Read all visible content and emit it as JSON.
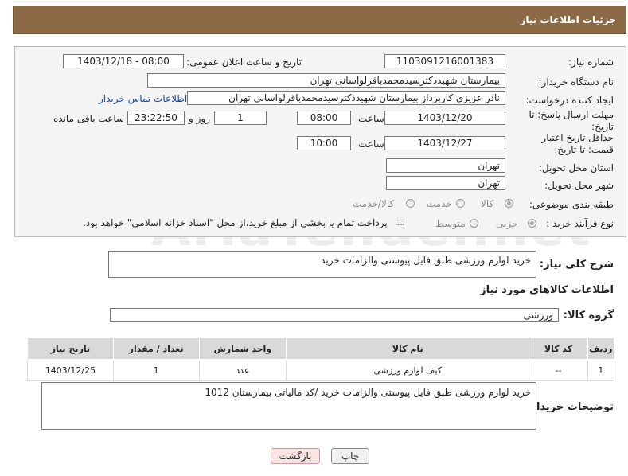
{
  "header": {
    "title": "جزئیات اطلاعات نیاز"
  },
  "form": {
    "need_number_label": "شماره نیاز:",
    "need_number": "1103091216001383",
    "announce_label": "تاریخ و ساعت اعلان عمومی:",
    "announce_value": "1403/12/18 - 08:00",
    "buyer_org_label": "نام دستگاه خریدار:",
    "buyer_org": "بیمارستان شهیدذکترسیدمحمدباقرلواسانی تهران",
    "creator_label": "ایجاد کننده درخواست:",
    "creator": "نادر  عزیزی کارپرداز بیمارستان شهیدذکترسیدمحمدباقرلواسانی تهران",
    "contact_link": "اطلاعات تماس خریدار",
    "deadline_label": "مهلت ارسال پاسخ: تا تاریخ:",
    "deadline_date": "1403/12/20",
    "time_label": "ساعت",
    "deadline_time": "08:00",
    "days_value": "1",
    "days_label": "روز و",
    "remaining_time": "23:22:50",
    "remaining_label": "ساعت باقی مانده",
    "price_validity_label": "حداقل تاریخ اعتبار قیمت: تا تاریخ:",
    "price_validity_date": "1403/12/27",
    "price_validity_time": "10:00",
    "province_label": "استان محل تحویل:",
    "province": "تهران",
    "city_label": "شهر محل تحویل:",
    "city": "تهران",
    "category_label": "طبقه بندی موضوعی:",
    "category_options": [
      "کالا",
      "خدمت",
      "کالا/خدمت"
    ],
    "purchase_type_label": "نوع فرآیند خرید :",
    "purchase_options": [
      "جزیی",
      "متوسط"
    ],
    "payment_note": "پرداخت تمام یا بخشی از مبلغ خرید،از محل \"اسناد خزانه اسلامی\" خواهد بود."
  },
  "description": {
    "label": "شرح کلی نیاز:",
    "value": "خرید لوازم ورزشی طبق فایل پیوستی والزامات خرید"
  },
  "goods": {
    "section_title": "اطلاعات کالاهای مورد نیاز",
    "group_label": "گروه کالا:",
    "group_value": "ورزشی",
    "columns": [
      "ردیف",
      "کد کالا",
      "نام کالا",
      "واحد شمارش",
      "تعداد / مقدار",
      "تاریخ نیاز"
    ],
    "rows": [
      [
        "1",
        "--",
        "کیف لوازم ورزشی",
        "عدد",
        "1",
        "1403/12/25"
      ]
    ]
  },
  "buyer_notes": {
    "label": "توضیحات خریدار:",
    "value": "خرید لوازم ورزشی طبق فایل پیوستی والزامات خرید /کد مالیاتی بیمارستان 1012"
  },
  "buttons": {
    "print": "چاپ",
    "back": "بازگشت"
  },
  "watermark": "AriaTender.net"
}
